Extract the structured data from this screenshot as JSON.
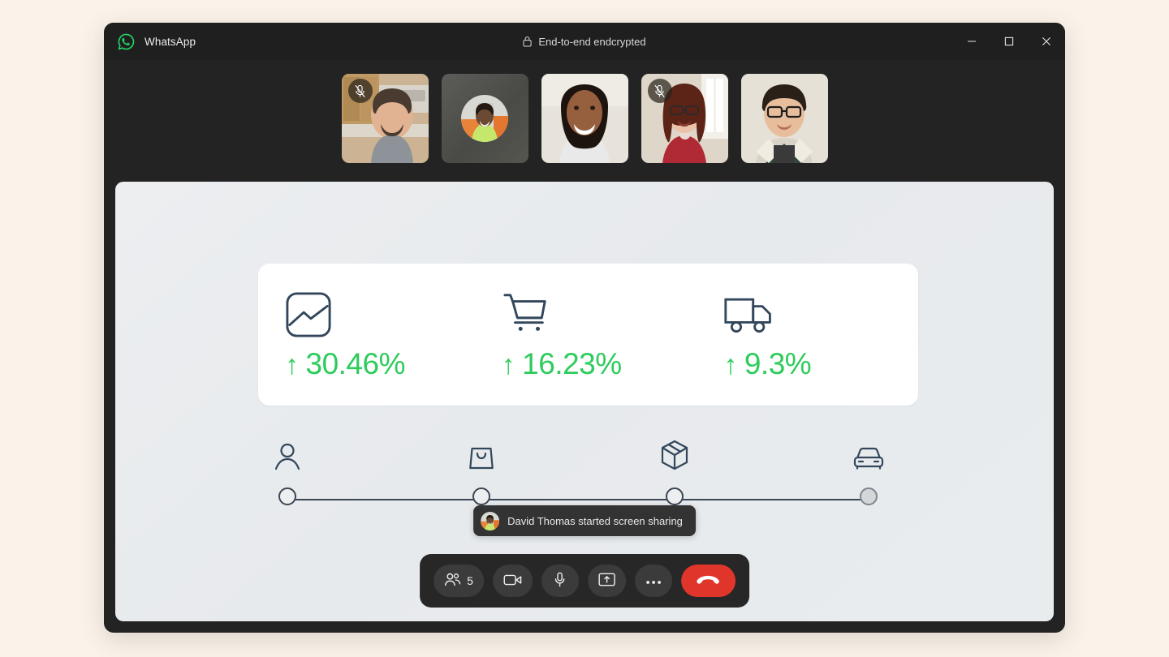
{
  "window": {
    "app_name": "WhatsApp",
    "logo_icon": "whatsapp-logo-icon",
    "encryption_label": "End-to-end endcrypted",
    "lock_icon": "lock-icon",
    "minimize_label": "Minimize",
    "maximize_label": "Maximize",
    "close_label": "Close",
    "accent_green": "#25d366",
    "titlebar_bg": "#1f1f1f",
    "body_bg": "#232323",
    "page_bg": "#faf3ea"
  },
  "participants": [
    {
      "id": 1,
      "name": "",
      "video": "on",
      "muted": true,
      "mic_icon": "mic-off-icon"
    },
    {
      "id": 2,
      "name": "David Thomas",
      "video": "off",
      "muted": false,
      "mic_icon": ""
    },
    {
      "id": 3,
      "name": "",
      "video": "on",
      "muted": false,
      "mic_icon": ""
    },
    {
      "id": 4,
      "name": "",
      "video": "on",
      "muted": true,
      "mic_icon": "mic-off-icon"
    },
    {
      "id": 5,
      "name": "",
      "video": "on",
      "muted": false,
      "mic_icon": ""
    }
  ],
  "shared_screen": {
    "metrics": [
      {
        "icon": "image-chart-icon",
        "arrow": "↑",
        "value": "30.46%",
        "trend": "up",
        "color": "#2ecc5c"
      },
      {
        "icon": "shopping-cart-icon",
        "arrow": "↑",
        "value": "16.23%",
        "trend": "up",
        "color": "#2ecc5c"
      },
      {
        "icon": "delivery-truck-icon",
        "arrow": "↑",
        "value": "9.3%",
        "trend": "up",
        "color": "#2ecc5c"
      }
    ],
    "timeline": {
      "line_color": "#3b4754",
      "steps": [
        {
          "icon": "person-icon",
          "position": 0,
          "state": "open"
        },
        {
          "icon": "shopping-bag-icon",
          "position": 33.3,
          "state": "open"
        },
        {
          "icon": "package-box-icon",
          "position": 66.6,
          "state": "open"
        },
        {
          "icon": "car-icon",
          "position": 100,
          "state": "filled"
        }
      ]
    }
  },
  "toast": {
    "avatar_icon": "participant-avatar",
    "message": "David Thomas started screen sharing"
  },
  "controls": [
    {
      "name": "participants-button",
      "icon": "people-icon",
      "count": "5",
      "style": "normal"
    },
    {
      "name": "camera-button",
      "icon": "video-camera-icon",
      "count": "",
      "style": "normal"
    },
    {
      "name": "microphone-button",
      "icon": "microphone-icon",
      "count": "",
      "style": "normal"
    },
    {
      "name": "share-screen-button",
      "icon": "screen-share-icon",
      "count": "",
      "style": "normal"
    },
    {
      "name": "more-options-button",
      "icon": "ellipsis-icon",
      "count": "",
      "style": "normal"
    },
    {
      "name": "end-call-button",
      "icon": "hang-up-icon",
      "count": "",
      "style": "end"
    }
  ],
  "control_colors": {
    "bar_bg": "#272727",
    "button_bg": "#3b3b3b",
    "end_call": "#e0352b"
  }
}
